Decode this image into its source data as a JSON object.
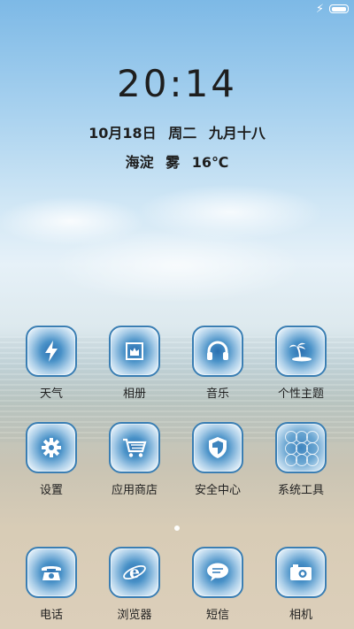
{
  "status_bar": {
    "charging_icon": "lightning-bolt-icon",
    "battery_icon": "battery-icon"
  },
  "lockscreen": {
    "time": "20:14",
    "date": "10月18日",
    "weekday": "周二",
    "lunar_date": "九月十八",
    "location": "海淀",
    "weather": "雾",
    "temperature": "16℃"
  },
  "apps_row1": [
    {
      "label": "天气",
      "icon": "weather-bolt-icon"
    },
    {
      "label": "相册",
      "icon": "gallery-icon"
    },
    {
      "label": "音乐",
      "icon": "headphones-icon"
    },
    {
      "label": "个性主题",
      "icon": "palm-island-icon"
    }
  ],
  "apps_row2": [
    {
      "label": "设置",
      "icon": "gear-icon"
    },
    {
      "label": "应用商店",
      "icon": "shopping-cart-icon"
    },
    {
      "label": "安全中心",
      "icon": "shield-icon"
    },
    {
      "label": "系统工具",
      "icon": "tools-folder-icon"
    }
  ],
  "dock": [
    {
      "label": "电话",
      "icon": "phone-icon"
    },
    {
      "label": "浏览器",
      "icon": "browser-icon"
    },
    {
      "label": "短信",
      "icon": "message-bubble-icon"
    },
    {
      "label": "相机",
      "icon": "camera-icon"
    }
  ],
  "page_indicator": {
    "pages": 1,
    "current": 1
  },
  "colors": {
    "icon_border": "#3a7eb3",
    "icon_fill": "#2a6fb0",
    "text": "#1e1e1e"
  }
}
